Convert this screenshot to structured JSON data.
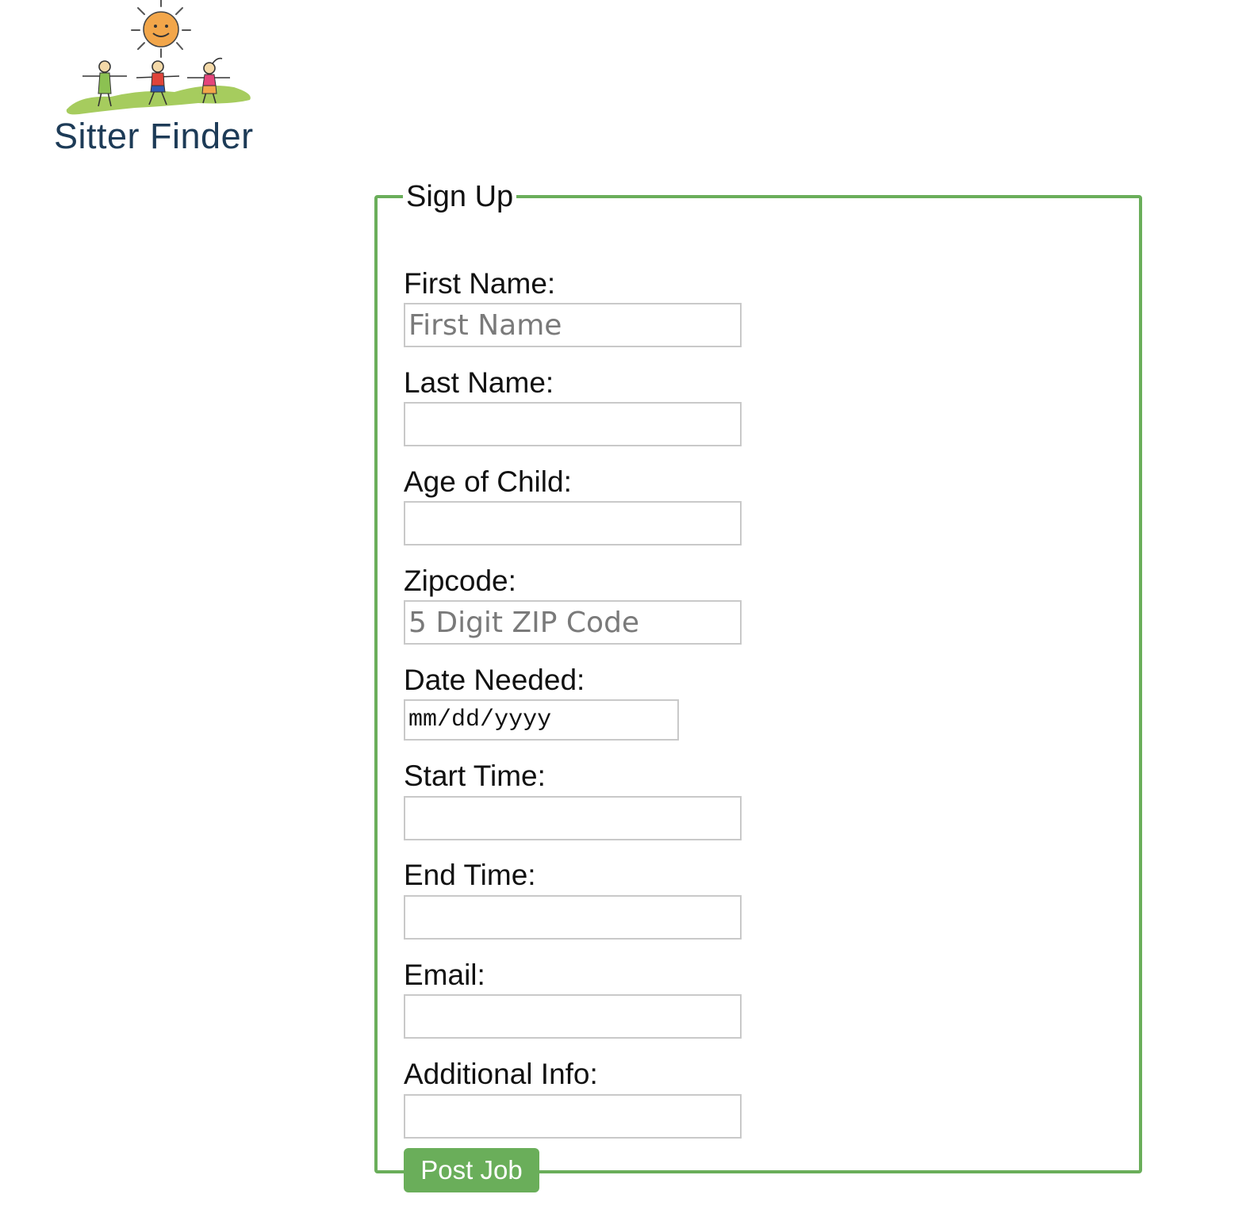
{
  "brand": {
    "name": "Sitter Finder"
  },
  "form": {
    "legend": "Sign Up",
    "fields": [
      {
        "label": "First Name:",
        "placeholder": "First Name",
        "value": ""
      },
      {
        "label": "Last Name:",
        "placeholder": "",
        "value": ""
      },
      {
        "label": "Age of Child:",
        "placeholder": "",
        "value": ""
      },
      {
        "label": "Zipcode:",
        "placeholder": "5 Digit ZIP Code",
        "value": ""
      },
      {
        "label": "Date Needed:",
        "placeholder": "mm/dd/yyyy",
        "value": ""
      },
      {
        "label": "Start Time:",
        "placeholder": "",
        "value": ""
      },
      {
        "label": "End Time:",
        "placeholder": "",
        "value": ""
      },
      {
        "label": "Email:",
        "placeholder": "",
        "value": ""
      },
      {
        "label": "Additional Info:",
        "placeholder": "",
        "value": ""
      }
    ],
    "date_parts": [
      "mm",
      "/",
      "dd",
      "/",
      "yyyy"
    ],
    "submit_label": "Post Job"
  },
  "colors": {
    "accent": "#6aae5a",
    "brand_text": "#1d3b57",
    "input_border": "#c9c9c9"
  },
  "icons": [
    "sitter-finder-logo-icon"
  ]
}
